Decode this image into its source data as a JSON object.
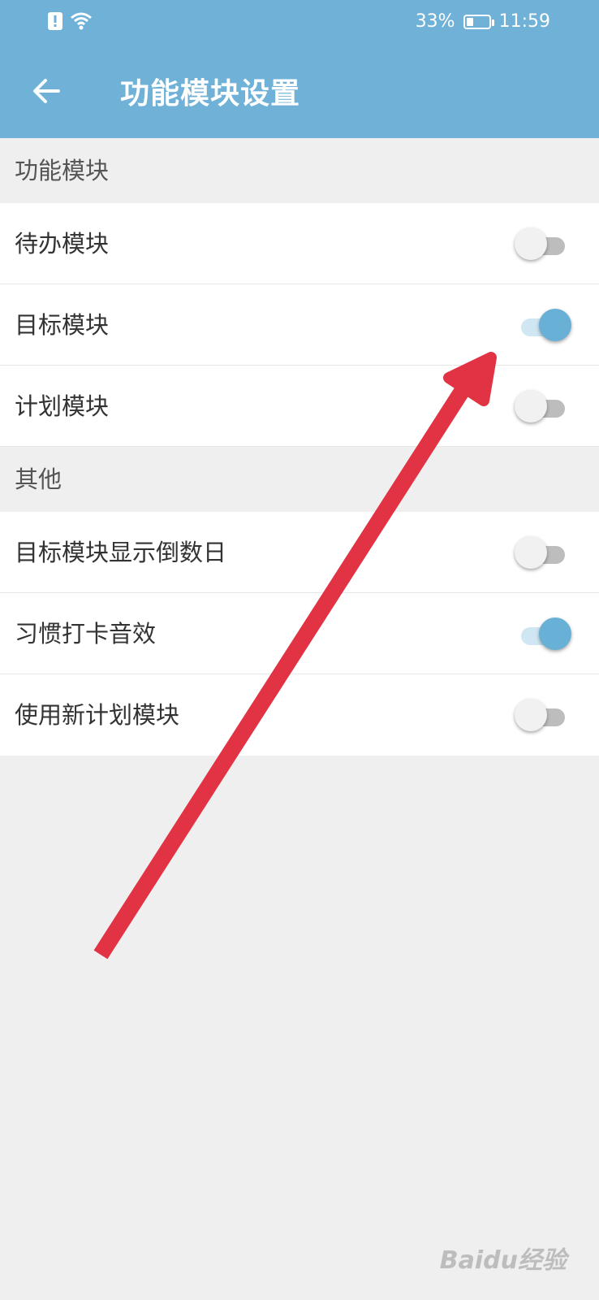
{
  "status_bar": {
    "battery_percent": "33%",
    "battery_level": 0.33,
    "time": "11:59"
  },
  "app_bar": {
    "back_icon": "arrow-left-icon",
    "title": "功能模块设置"
  },
  "sections": [
    {
      "header": "功能模块",
      "items": [
        {
          "label": "待办模块",
          "on": false
        },
        {
          "label": "目标模块",
          "on": true
        },
        {
          "label": "计划模块",
          "on": false
        }
      ]
    },
    {
      "header": "其他",
      "items": [
        {
          "label": "目标模块显示倒数日",
          "on": false
        },
        {
          "label": "习惯打卡音效",
          "on": true
        },
        {
          "label": "使用新计划模块",
          "on": false
        }
      ]
    }
  ],
  "watermark": "Baidu经验",
  "colors": {
    "app_bar": "#6fb1d7",
    "toggle_on": "#68b0d6",
    "arrow": "#e13344"
  }
}
